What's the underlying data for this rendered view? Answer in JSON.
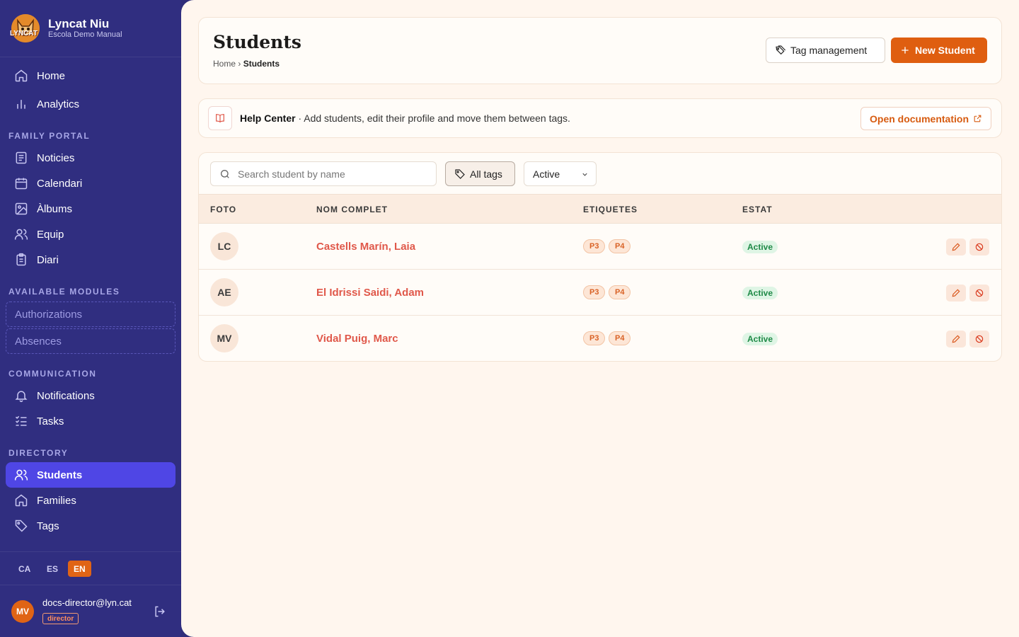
{
  "brand": {
    "name": "Lyncat Niu",
    "school": "Escola Demo Manual",
    "logo_text": "LYNCAT"
  },
  "nav": {
    "home": "Home",
    "analytics": "Analytics",
    "family_portal_title": "FAMILY PORTAL",
    "family_portal": [
      {
        "label": "Noticies",
        "icon": "newspaper-icon"
      },
      {
        "label": "Calendari",
        "icon": "calendar-icon"
      },
      {
        "label": "Àlbums",
        "icon": "image-icon"
      },
      {
        "label": "Equip",
        "icon": "users-icon"
      },
      {
        "label": "Diari",
        "icon": "clipboard-icon"
      }
    ],
    "modules_title": "AVAILABLE MODULES",
    "modules": [
      "Authorizations",
      "Absences"
    ],
    "communication_title": "COMMUNICATION",
    "communication": [
      {
        "label": "Notifications",
        "icon": "bell-icon"
      },
      {
        "label": "Tasks",
        "icon": "tasklist-icon"
      }
    ],
    "directory_title": "DIRECTORY",
    "directory": [
      {
        "label": "Students",
        "icon": "users-icon",
        "active": true
      },
      {
        "label": "Families",
        "icon": "house-icon"
      },
      {
        "label": "Tags",
        "icon": "tag-icon"
      }
    ]
  },
  "languages": {
    "ca": "CA",
    "es": "ES",
    "en": "EN",
    "selected": "EN"
  },
  "user": {
    "initials": "MV",
    "email": "docs-director@lyn.cat",
    "role": "director"
  },
  "header": {
    "title": "Students",
    "breadcrumb_home": "Home",
    "breadcrumb_sep": "›",
    "breadcrumb_current": "Students",
    "tag_management": "Tag management",
    "new_student": "New Student"
  },
  "help": {
    "title": "Help Center",
    "text": " · Add students, edit their profile and move them between tags.",
    "doc_button": "Open documentation"
  },
  "filters": {
    "search_placeholder": "Search student by name",
    "tags_filter": "All tags",
    "status": "Active"
  },
  "table": {
    "columns": {
      "photo": "FOTO",
      "name": "NOM COMPLET",
      "tags": "ETIQUETES",
      "status": "ESTAT"
    },
    "rows": [
      {
        "initials": "LC",
        "name": "Castells Marín, Laia",
        "tags": [
          "P3",
          "P4"
        ],
        "status": "Active"
      },
      {
        "initials": "AE",
        "name": "El Idrissi Saidi, Adam",
        "tags": [
          "P3",
          "P4"
        ],
        "status": "Active"
      },
      {
        "initials": "MV",
        "name": "Vidal Puig, Marc",
        "tags": [
          "P3",
          "P4"
        ],
        "status": "Active"
      }
    ]
  },
  "colors": {
    "sidebar": "#302e80",
    "active_nav": "#4f46e5",
    "accent": "#df5e10",
    "link": "#e0584a",
    "status_active": "#1f8a47"
  }
}
